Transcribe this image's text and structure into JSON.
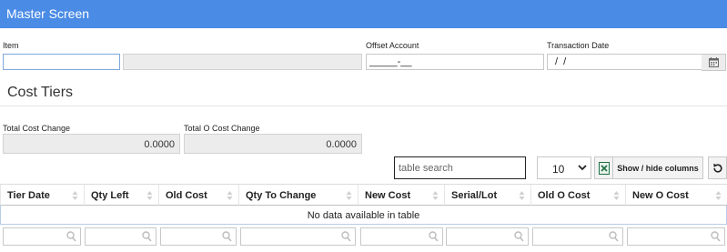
{
  "window": {
    "title": "Master Screen"
  },
  "form": {
    "item_label": "Item",
    "item_value": "",
    "item_desc_value": "",
    "offset_label": "Offset Account",
    "offset_mask": "_____-__",
    "trans_date_label": "Transaction Date",
    "trans_date_mask": "/  /"
  },
  "section": {
    "title": "Cost Tiers"
  },
  "totals": {
    "total_cost_label": "Total Cost Change",
    "total_cost_value": "0.0000",
    "total_o_cost_label": "Total O Cost Change",
    "total_o_cost_value": "0.0000"
  },
  "toolbar": {
    "search_placeholder": "table search",
    "page_length": "10",
    "show_hide_label": "Show / hide columns",
    "export_icon": "excel-icon",
    "refresh_icon": "refresh-icon"
  },
  "table": {
    "columns": [
      "Tier Date",
      "Qty Left",
      "Old Cost",
      "Qty To Change",
      "New Cost",
      "Serial/Lot",
      "Old O Cost",
      "New O Cost"
    ],
    "empty_message": "No data available in table"
  },
  "colors": {
    "titlebar": "#4a8be6",
    "excel": "#1e7145"
  }
}
